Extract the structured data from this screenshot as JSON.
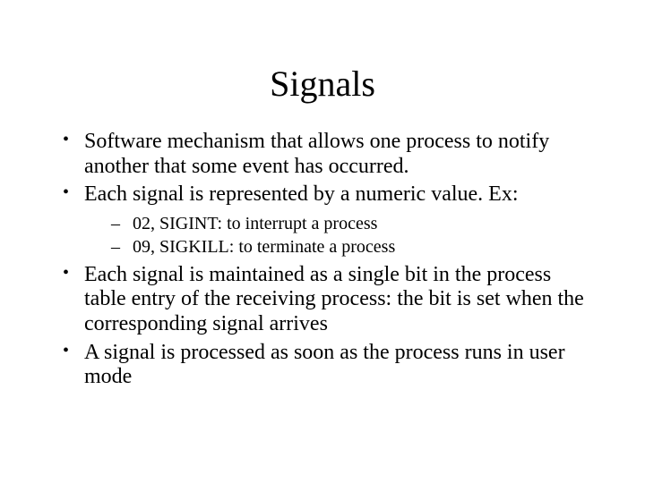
{
  "slide": {
    "title": "Signals",
    "bullets": [
      {
        "text": "Software mechanism that allows one process to notify another that some event has occurred."
      },
      {
        "text": "Each signal is represented by a numeric value. Ex:",
        "sub": [
          "02, SIGINT: to interrupt a process",
          "09, SIGKILL: to terminate a process"
        ]
      },
      {
        "text": "Each signal is maintained as a single bit in the process table entry of the receiving process: the bit is set when the corresponding signal arrives"
      },
      {
        "text": "A signal is processed as soon as the process runs in user mode"
      }
    ]
  }
}
